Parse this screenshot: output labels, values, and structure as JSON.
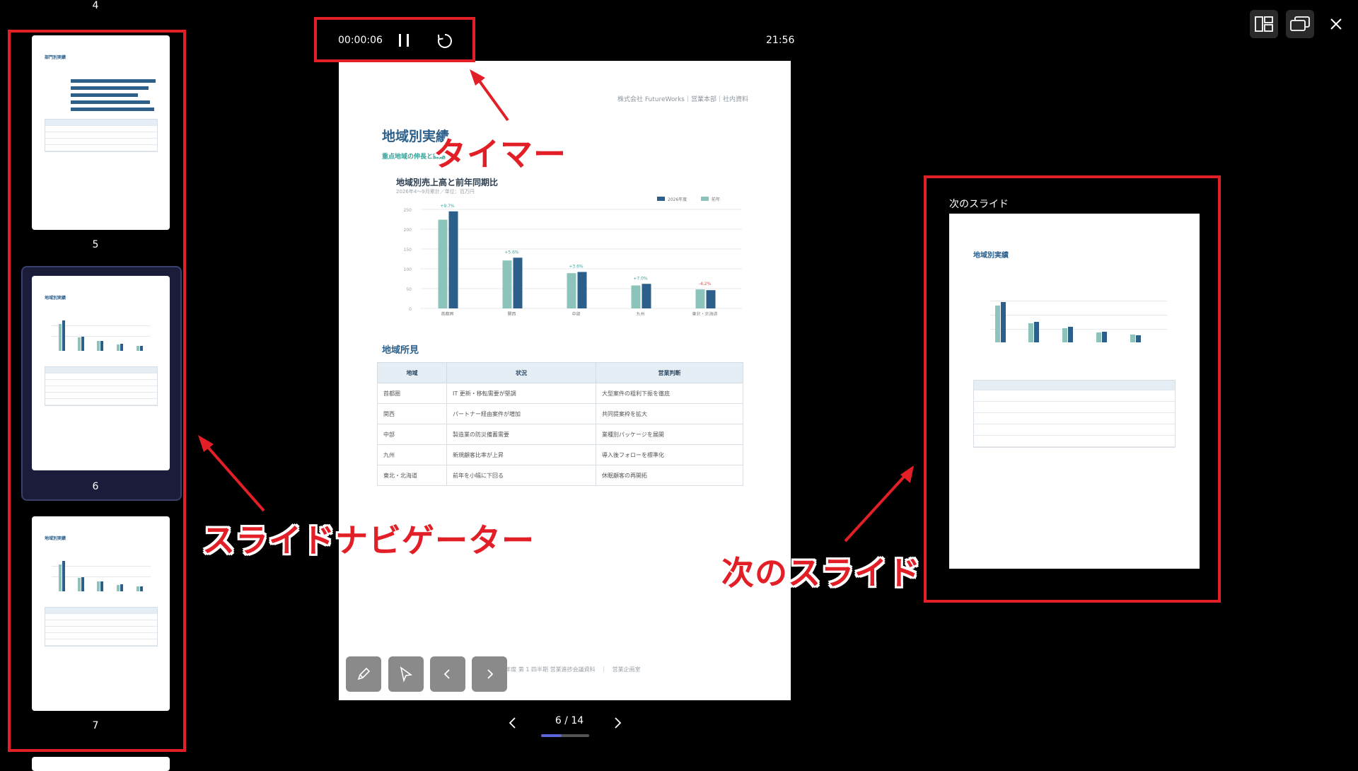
{
  "timer": {
    "elapsed": "00:00:06",
    "clock": "21:56"
  },
  "navigator": {
    "thumbnails": [
      {
        "number": "4"
      },
      {
        "number": "5",
        "title": "部門別実績"
      },
      {
        "number": "6",
        "title": "地域別実績"
      },
      {
        "number": "7",
        "title": "地域別実績"
      }
    ]
  },
  "slide": {
    "header": "株式会社 FutureWorks｜営業本部｜社内資料",
    "title": "地域別実績",
    "subtitle": "重点地域の伸長と課題",
    "chart_title": "地域別売上高と前年同期比",
    "chart_subtitle": "2026年4〜9月累計／単位：百万円",
    "section_title": "地域所見",
    "table": {
      "headers": [
        "地域",
        "状況",
        "営業判断"
      ],
      "rows": [
        [
          "首都圏",
          "IT 更新・移転需要が堅調",
          "大型案件の粗利下振を徹底"
        ],
        [
          "関西",
          "パートナー経由案件が増加",
          "共同提案枠を拡大"
        ],
        [
          "中部",
          "製造業の防災備蓄需要",
          "業種別パッケージを展開"
        ],
        [
          "九州",
          "新規顧客比率が上昇",
          "導入後フォローを標準化"
        ],
        [
          "東北・北海道",
          "前年を小幅に下回る",
          "休眠顧客の再開拓"
        ]
      ]
    },
    "footer": "2026 年度 第 1 四半期 営業進捗会議資料　｜　営業企画室"
  },
  "chart_data": {
    "type": "bar",
    "title": "地域別売上高と前年同期比",
    "categories": [
      "首都圏",
      "関西",
      "中部",
      "九州",
      "東北・北海道"
    ],
    "series": [
      {
        "name": "2026年度",
        "values": [
          245,
          128,
          92,
          62,
          46
        ],
        "color": "#2c5f8a"
      },
      {
        "name": "前年",
        "values": [
          224,
          121,
          89,
          58,
          48
        ],
        "color": "#8cc4bb"
      }
    ],
    "yoy_labels": [
      "+9.7%",
      "+5.6%",
      "+3.6%",
      "+7.0%",
      "-4.2%"
    ],
    "y_ticks": [
      "250",
      "200",
      "150",
      "100",
      "50",
      "0"
    ],
    "ylim": [
      0,
      250
    ],
    "grid": true,
    "legend": "top-right"
  },
  "next_slide": {
    "label": "次のスライド",
    "title": "地域別実績"
  },
  "pager": {
    "text": "6 / 14",
    "progress": 0.43
  },
  "annotations": {
    "timer": "タイマー",
    "navigator": "スライドナビゲーター",
    "next": "次のスライド"
  },
  "colors": {
    "accent": "#e21e26",
    "navy": "#2c5f8a",
    "teal": "#8cc4bb",
    "progress": "#5a67d8"
  }
}
